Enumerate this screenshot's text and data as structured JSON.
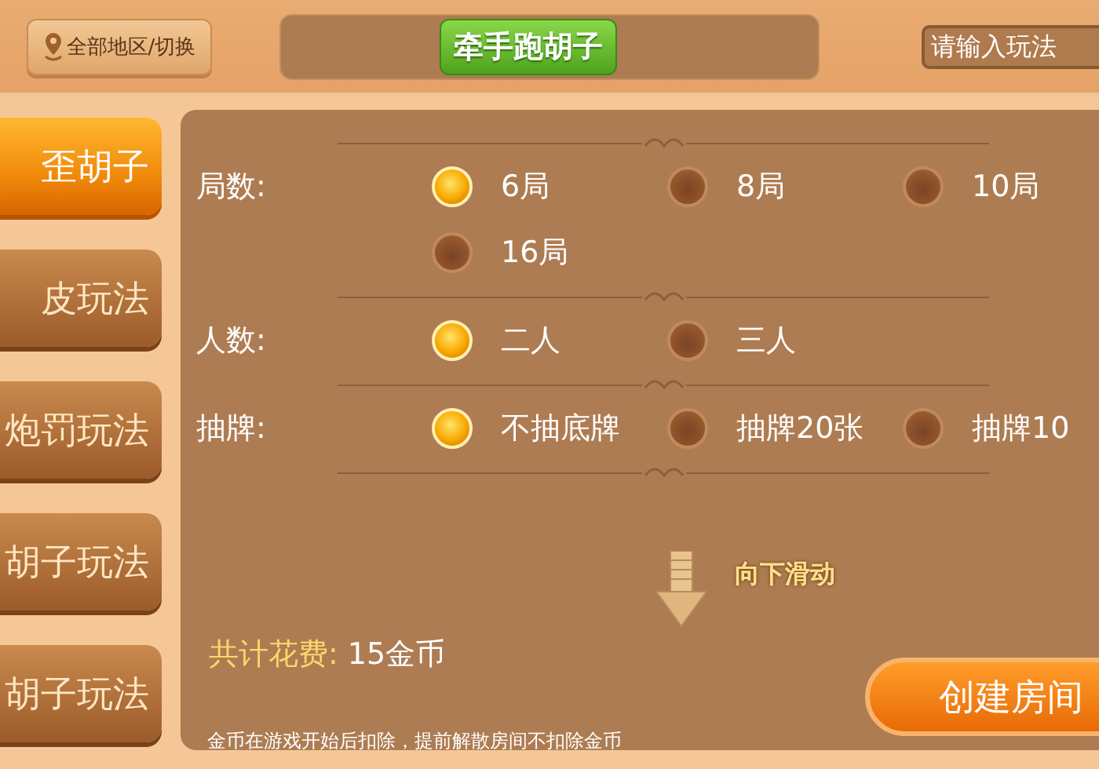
{
  "header": {
    "location_button": "全部地区/切换",
    "title": "牵手跑胡子",
    "search": {
      "placeholder": "请输入玩法"
    }
  },
  "sidebar": [
    {
      "label": "歪胡子",
      "selected": true
    },
    {
      "label": "皮玩法",
      "selected": false
    },
    {
      "label": "炮罚玩法",
      "selected": false
    },
    {
      "label": "胡子玩法",
      "selected": false
    },
    {
      "label": "胡子玩法",
      "selected": false
    }
  ],
  "rules": [
    {
      "label": "局数:",
      "options": [
        {
          "label": "6局",
          "selected": true
        },
        {
          "label": "8局",
          "selected": false
        },
        {
          "label": "10局",
          "selected": false
        },
        {
          "label": "16局",
          "selected": false
        }
      ]
    },
    {
      "label": "人数:",
      "options": [
        {
          "label": "二人",
          "selected": true
        },
        {
          "label": "三人",
          "selected": false
        }
      ]
    },
    {
      "label": "抽牌:",
      "options": [
        {
          "label": "不抽底牌",
          "selected": true
        },
        {
          "label": "抽牌20张",
          "selected": false
        },
        {
          "label": "抽牌10",
          "selected": false
        }
      ]
    }
  ],
  "scroll_hint": "向下滑动",
  "cost": {
    "label": "共计花费:",
    "value": "15金币"
  },
  "create_button": "创建房间",
  "note": "金币在游戏开始后扣除，提前解散房间不扣除金币"
}
